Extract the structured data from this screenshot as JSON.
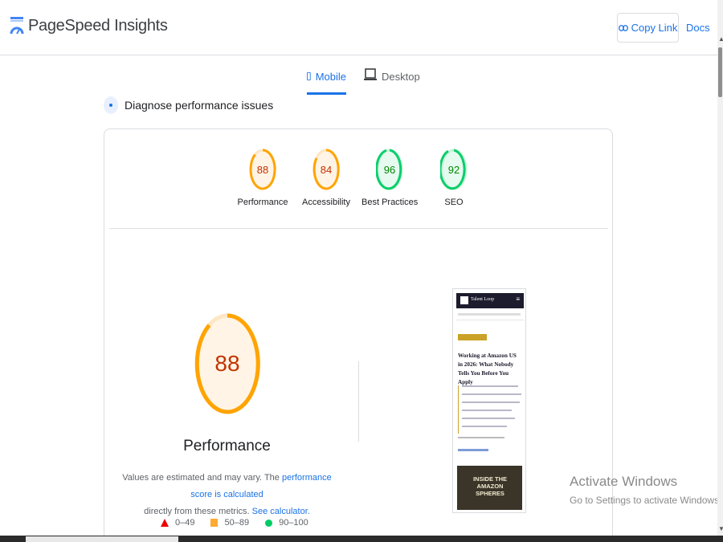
{
  "header": {
    "title": "PageSpeed Insights",
    "copy_link_label": "Copy Link",
    "docs_label": "Docs"
  },
  "tabs": [
    {
      "label": "Mobile",
      "icon": "smartphone-icon",
      "active": true
    },
    {
      "label": "Desktop",
      "icon": "laptop-icon",
      "active": false
    }
  ],
  "diagnose": {
    "title": "Diagnose performance issues"
  },
  "scores": [
    {
      "label": "Performance",
      "value": "88",
      "color": "#ffa400",
      "text_color": "#c33300"
    },
    {
      "label": "Accessibility",
      "value": "84",
      "color": "#ffa400",
      "text_color": "#c33300"
    },
    {
      "label": "Best Practices",
      "value": "96",
      "color": "#0cce6b",
      "text_color": "#008800"
    },
    {
      "label": "SEO",
      "value": "92",
      "color": "#0cce6b",
      "text_color": "#008800"
    }
  ],
  "performance": {
    "score": "88",
    "label": "Performance",
    "note_prefix": "Values are estimated and may vary. The ",
    "note_link1": "performance score is calculated",
    "note_middle": "directly from these metrics.",
    "note_link2": "See calculator."
  },
  "legend": [
    {
      "range": "0–49",
      "shape": "triangle",
      "color": "#ff0000"
    },
    {
      "range": "50–89",
      "shape": "square",
      "color": "#ffaa33"
    },
    {
      "range": "90–100",
      "shape": "circle",
      "color": "#00cc66"
    }
  ],
  "thumbnail": {
    "brand": "Talent Loop",
    "headline": "Working at Amazon US in 2026: What Nobody Tells You Before You Apply",
    "image_text": "INSIDE THE AMAZON SPHERES"
  },
  "watermark": {
    "title": "Activate Windows",
    "subtitle": "Go to Settings to activate Windows."
  }
}
